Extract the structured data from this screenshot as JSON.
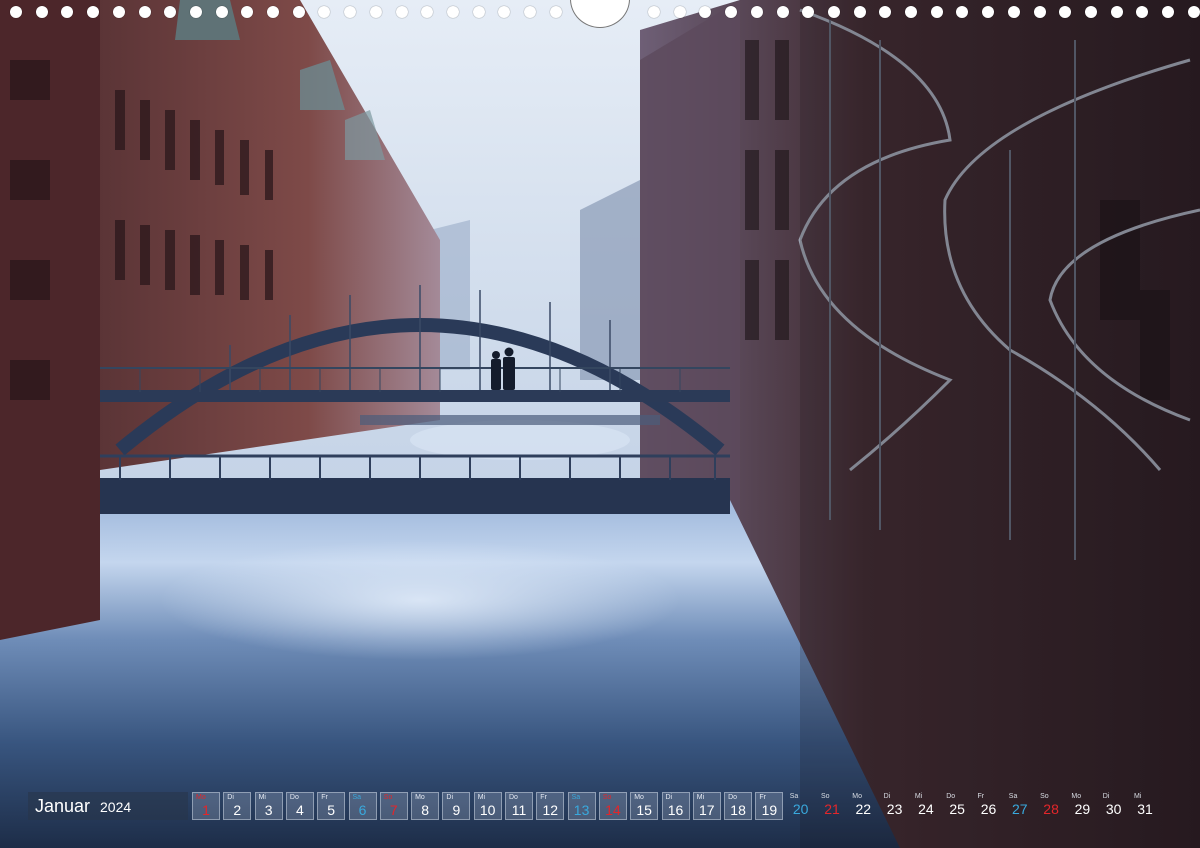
{
  "calendar": {
    "month": "Januar",
    "year": "2024",
    "days": [
      {
        "wd": "Mo",
        "num": "1",
        "type": "sun"
      },
      {
        "wd": "Di",
        "num": "2",
        "type": "normal"
      },
      {
        "wd": "Mi",
        "num": "3",
        "type": "normal"
      },
      {
        "wd": "Do",
        "num": "4",
        "type": "normal"
      },
      {
        "wd": "Fr",
        "num": "5",
        "type": "normal"
      },
      {
        "wd": "Sa",
        "num": "6",
        "type": "sat"
      },
      {
        "wd": "So",
        "num": "7",
        "type": "sun"
      },
      {
        "wd": "Mo",
        "num": "8",
        "type": "normal"
      },
      {
        "wd": "Di",
        "num": "9",
        "type": "normal"
      },
      {
        "wd": "Mi",
        "num": "10",
        "type": "normal"
      },
      {
        "wd": "Do",
        "num": "11",
        "type": "normal"
      },
      {
        "wd": "Fr",
        "num": "12",
        "type": "normal"
      },
      {
        "wd": "Sa",
        "num": "13",
        "type": "sat"
      },
      {
        "wd": "So",
        "num": "14",
        "type": "sun"
      },
      {
        "wd": "Mo",
        "num": "15",
        "type": "normal"
      },
      {
        "wd": "Di",
        "num": "16",
        "type": "normal"
      },
      {
        "wd": "Mi",
        "num": "17",
        "type": "normal"
      },
      {
        "wd": "Do",
        "num": "18",
        "type": "normal"
      },
      {
        "wd": "Fr",
        "num": "19",
        "type": "normal"
      },
      {
        "wd": "Sa",
        "num": "20",
        "type": "sat"
      },
      {
        "wd": "So",
        "num": "21",
        "type": "sun"
      },
      {
        "wd": "Mo",
        "num": "22",
        "type": "normal"
      },
      {
        "wd": "Di",
        "num": "23",
        "type": "normal"
      },
      {
        "wd": "Mi",
        "num": "24",
        "type": "normal"
      },
      {
        "wd": "Do",
        "num": "25",
        "type": "normal"
      },
      {
        "wd": "Fr",
        "num": "26",
        "type": "normal"
      },
      {
        "wd": "Sa",
        "num": "27",
        "type": "sat"
      },
      {
        "wd": "So",
        "num": "28",
        "type": "sun"
      },
      {
        "wd": "Mo",
        "num": "29",
        "type": "normal"
      },
      {
        "wd": "Di",
        "num": "30",
        "type": "normal"
      },
      {
        "wd": "Mi",
        "num": "31",
        "type": "normal"
      }
    ]
  },
  "colors": {
    "saturday": "#39a9dd",
    "sunday": "#e3262a",
    "fog": "#c9d7ea",
    "brick": "#7a3a34"
  }
}
